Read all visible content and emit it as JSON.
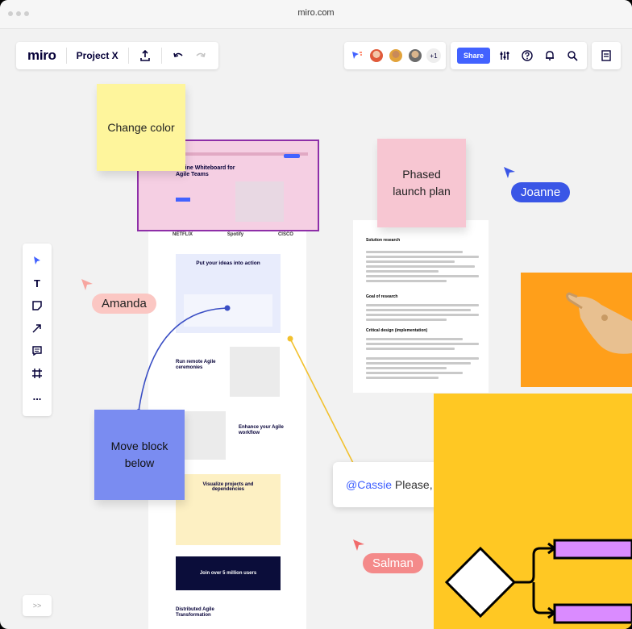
{
  "browser": {
    "url": "miro.com"
  },
  "header": {
    "logo": "miro",
    "project_name": "Project X",
    "share_label": "Share",
    "extra_collaborators": "+1"
  },
  "toolbar": {
    "tools": [
      "select-icon",
      "text-icon",
      "sticky-note-icon",
      "arrow-icon",
      "comment-icon",
      "frame-icon",
      "more-icon"
    ],
    "text_tool": "T",
    "more": "..."
  },
  "stickies": {
    "change_color": "Change color",
    "phased_launch": "Phased launch plan",
    "move_block": "Move block below"
  },
  "cursors": {
    "joanne": "Joanne",
    "amanda": "Amanda",
    "salman": "Salman"
  },
  "comment": {
    "mention": "@Cassie",
    "text": " Please,"
  },
  "landing_page": {
    "hero_title": "Online Whiteboard for Agile Teams",
    "logos": [
      "NETFLIX",
      "Spotify",
      "CISCO"
    ],
    "section1": "Put your ideas into action",
    "section2": "Run remote Agile ceremonies",
    "section3": "Enhance your Agile workflow",
    "section4": "Visualize projects and dependencies",
    "cta": "Join over 5 million users",
    "footer": "Distributed Agile Transformation"
  },
  "research_doc": {
    "heading": "Solution research",
    "heading2": "Goal of research",
    "heading3": "Critical design (implementation)"
  },
  "pagination": {
    "label": ">>"
  },
  "colors": {
    "yellow_sticky": "#fef59c",
    "pink_sticky": "#f7c6d2",
    "blue_sticky": "#7a8cf1",
    "accent": "#4262ff",
    "diagram_bg": "#ffc823"
  }
}
